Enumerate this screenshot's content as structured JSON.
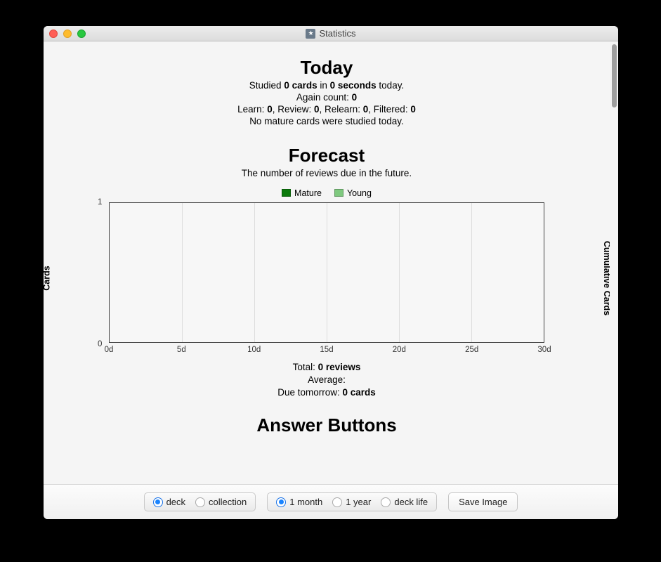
{
  "window": {
    "title": "Statistics"
  },
  "today": {
    "heading": "Today",
    "line1_pre": "Studied ",
    "line1_cards": "0 cards",
    "line1_mid": " in ",
    "line1_time": "0 seconds",
    "line1_post": " today.",
    "again_label": "Again count: ",
    "again_val": "0",
    "counts_learn_l": "Learn: ",
    "counts_learn_v": "0",
    "counts_review_l": ", Review: ",
    "counts_review_v": "0",
    "counts_relearn_l": ", Relearn: ",
    "counts_relearn_v": "0",
    "counts_filtered_l": ", Filtered: ",
    "counts_filtered_v": "0",
    "mature_line": "No mature cards were studied today."
  },
  "forecast": {
    "heading": "Forecast",
    "subtitle": "The number of reviews due in the future.",
    "legend_mature": "Mature",
    "legend_young": "Young",
    "y_left": "Cards",
    "y_right": "Cumulative Cards",
    "ytick_top": "1",
    "ytick_bot": "0",
    "xticks": [
      "0d",
      "5d",
      "10d",
      "15d",
      "20d",
      "25d",
      "30d"
    ],
    "total_l": "Total: ",
    "total_v": "0 reviews",
    "avg_l": "Average:",
    "avg_v": "",
    "due_l": "Due tomorrow: ",
    "due_v": "0 cards"
  },
  "answer": {
    "heading": "Answer Buttons"
  },
  "footer": {
    "scope": {
      "deck": "deck",
      "collection": "collection"
    },
    "range": {
      "month": "1 month",
      "year": "1 year",
      "life": "deck life"
    },
    "save": "Save Image"
  },
  "chart_data": {
    "type": "bar",
    "title": "Forecast",
    "categories": [
      "0d",
      "5d",
      "10d",
      "15d",
      "20d",
      "25d",
      "30d"
    ],
    "series": [
      {
        "name": "Mature",
        "values": [
          0,
          0,
          0,
          0,
          0,
          0,
          0
        ]
      },
      {
        "name": "Young",
        "values": [
          0,
          0,
          0,
          0,
          0,
          0,
          0
        ]
      }
    ],
    "xlabel": "",
    "ylabel": "Cards",
    "y2label": "Cumulative Cards",
    "ylim": [
      0,
      1
    ]
  }
}
